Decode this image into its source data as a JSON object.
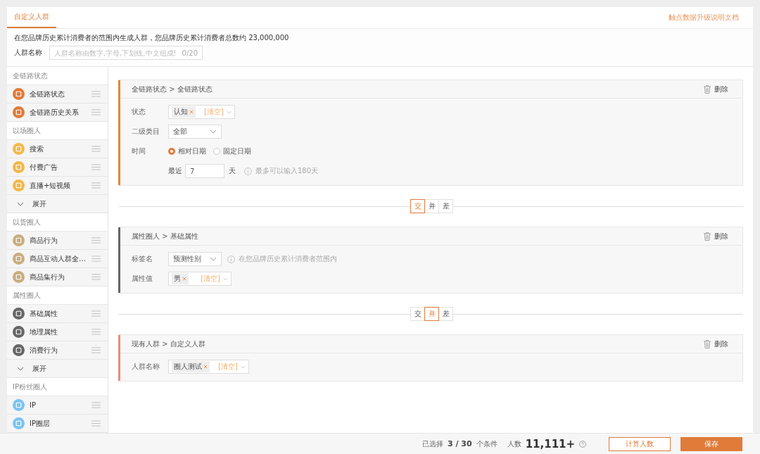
{
  "tabs": [
    {
      "label": "自定义人群",
      "selected": true
    }
  ],
  "doc_link": "触点数据升级说明文档",
  "intro": "在您品牌历史累计消费者的范围内生成人群，您品牌历史累计消费者总数约 23,000,000",
  "name_field": {
    "label": "人群名称",
    "placeholder": "人群名称由数字,字母,下划线,中文组成!",
    "count": "0/20"
  },
  "sidebar": [
    {
      "title": "全链路状态",
      "items": [
        {
          "kind": "item",
          "label": "全链路状态",
          "color": "#e07b39"
        },
        {
          "kind": "item",
          "label": "全链路历史关系",
          "color": "#e07b39"
        }
      ]
    },
    {
      "title": "以场圈人",
      "items": [
        {
          "kind": "item",
          "label": "搜索",
          "color": "#f2b84b"
        },
        {
          "kind": "item",
          "label": "付费广告",
          "color": "#f2b84b"
        },
        {
          "kind": "item",
          "label": "直播+短视频",
          "color": "#f2b84b"
        },
        {
          "kind": "expand",
          "label": "展开"
        }
      ]
    },
    {
      "title": "以货圈人",
      "items": [
        {
          "kind": "item",
          "label": "商品行为",
          "color": "#c8ad7f"
        },
        {
          "kind": "item",
          "label": "商品互动人群全…",
          "color": "#c8ad7f"
        },
        {
          "kind": "item",
          "label": "商品集行为",
          "color": "#c8ad7f"
        }
      ]
    },
    {
      "title": "属性圈人",
      "items": [
        {
          "kind": "item",
          "label": "基础属性",
          "color": "#666666"
        },
        {
          "kind": "item",
          "label": "地理属性",
          "color": "#666666"
        },
        {
          "kind": "item",
          "label": "消费行为",
          "color": "#666666"
        },
        {
          "kind": "expand",
          "label": "展开"
        }
      ]
    },
    {
      "title": "IP粉丝圈人",
      "items": [
        {
          "kind": "item",
          "label": "IP",
          "color": "#7cc3f2"
        },
        {
          "kind": "item",
          "label": "IP圈层",
          "color": "#7cc3f2"
        }
      ]
    }
  ],
  "flow": [
    {
      "kind": "condition",
      "path": "全链路状态 > 全链路状态",
      "color": "#e8843a",
      "delete": "删除",
      "fields": [
        {
          "kind": "tags",
          "label": "状态",
          "tags": [
            "认知"
          ],
          "clear": "[清空]"
        },
        {
          "kind": "select",
          "label": "二级类目",
          "value": "全部"
        },
        {
          "kind": "radio",
          "label": "时间",
          "options": [
            {
              "label": "相对日期",
              "selected": true
            },
            {
              "label": "固定日期",
              "selected": false
            }
          ]
        },
        {
          "kind": "days",
          "prefix": "最近",
          "value": "7",
          "suffix": "天",
          "hint": "最多可以输入180天"
        }
      ]
    },
    {
      "kind": "operator",
      "options": [
        {
          "label": "交",
          "selected": true
        },
        {
          "label": "并",
          "selected": false
        },
        {
          "label": "差",
          "selected": false
        }
      ]
    },
    {
      "kind": "condition",
      "path": "属性圈人 > 基础属性",
      "color": "#666666",
      "delete": "删除",
      "fields": [
        {
          "kind": "select",
          "label": "标签名",
          "value": "预测性别",
          "hint": "在您品牌历史累计消费者范围内"
        },
        {
          "kind": "tags",
          "label": "属性值",
          "tags": [
            "男"
          ],
          "clear": "[清空]"
        }
      ]
    },
    {
      "kind": "operator",
      "options": [
        {
          "label": "交",
          "selected": false
        },
        {
          "label": "并",
          "selected": true
        },
        {
          "label": "差",
          "selected": false
        }
      ]
    },
    {
      "kind": "condition",
      "path": "现有人群 > 自定义人群",
      "color": "#ea8a7a",
      "delete": "删除",
      "fields": [
        {
          "kind": "tags",
          "label": "人群名称",
          "tags": [
            "圈人测试"
          ],
          "clear": "[清空]"
        }
      ]
    }
  ],
  "footer": {
    "selected_label": "已选择",
    "selected_count": "3 / 30",
    "selected_unit": "个条件",
    "people_label": "人数",
    "people_count": "11,111+",
    "buttons": [
      {
        "kind": "outline",
        "label": "计算人数"
      },
      {
        "kind": "primary",
        "label": "保存"
      }
    ]
  }
}
